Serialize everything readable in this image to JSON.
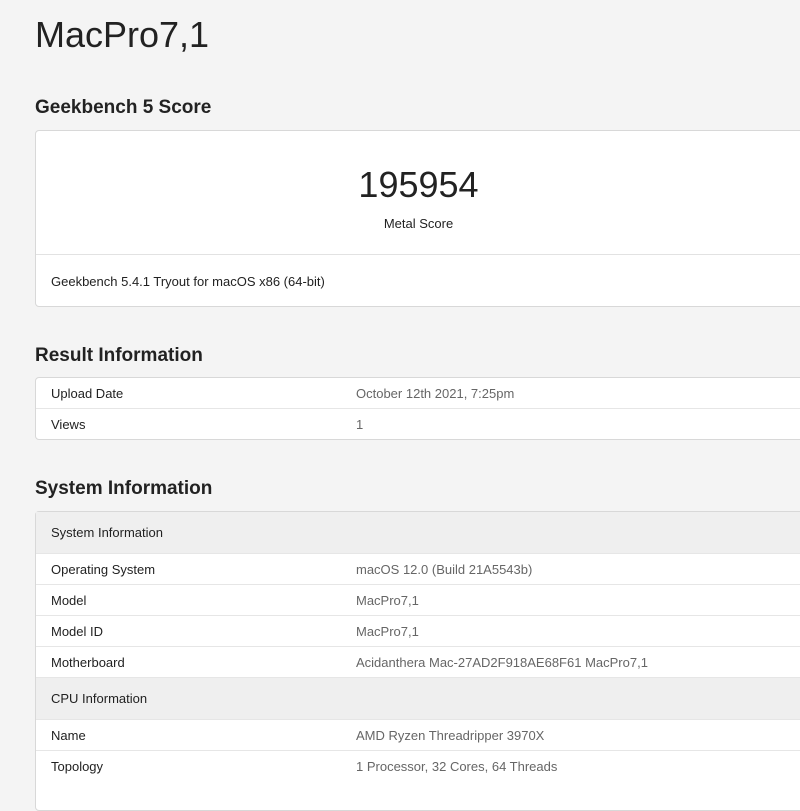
{
  "page_title": "MacPro7,1",
  "score_section": {
    "heading": "Geekbench 5 Score",
    "score": "195954",
    "score_label": "Metal Score",
    "version": "Geekbench 5.4.1 Tryout for macOS x86 (64-bit)"
  },
  "result_section": {
    "heading": "Result Information",
    "rows": [
      {
        "k": "Upload Date",
        "v": "October 12th 2021, 7:25pm"
      },
      {
        "k": "Views",
        "v": "1"
      }
    ]
  },
  "system_section": {
    "heading": "System Information",
    "sys_header": "System Information",
    "sys_rows": [
      {
        "k": "Operating System",
        "v": "macOS 12.0 (Build 21A5543b)"
      },
      {
        "k": "Model",
        "v": "MacPro7,1"
      },
      {
        "k": "Model ID",
        "v": "MacPro7,1"
      },
      {
        "k": "Motherboard",
        "v": "Acidanthera Mac-27AD2F918AE68F61 MacPro7,1"
      }
    ],
    "cpu_header": "CPU Information",
    "cpu_rows": [
      {
        "k": "Name",
        "v": "AMD Ryzen Threadripper 3970X"
      },
      {
        "k": "Topology",
        "v": "1 Processor, 32 Cores, 64 Threads"
      }
    ]
  }
}
